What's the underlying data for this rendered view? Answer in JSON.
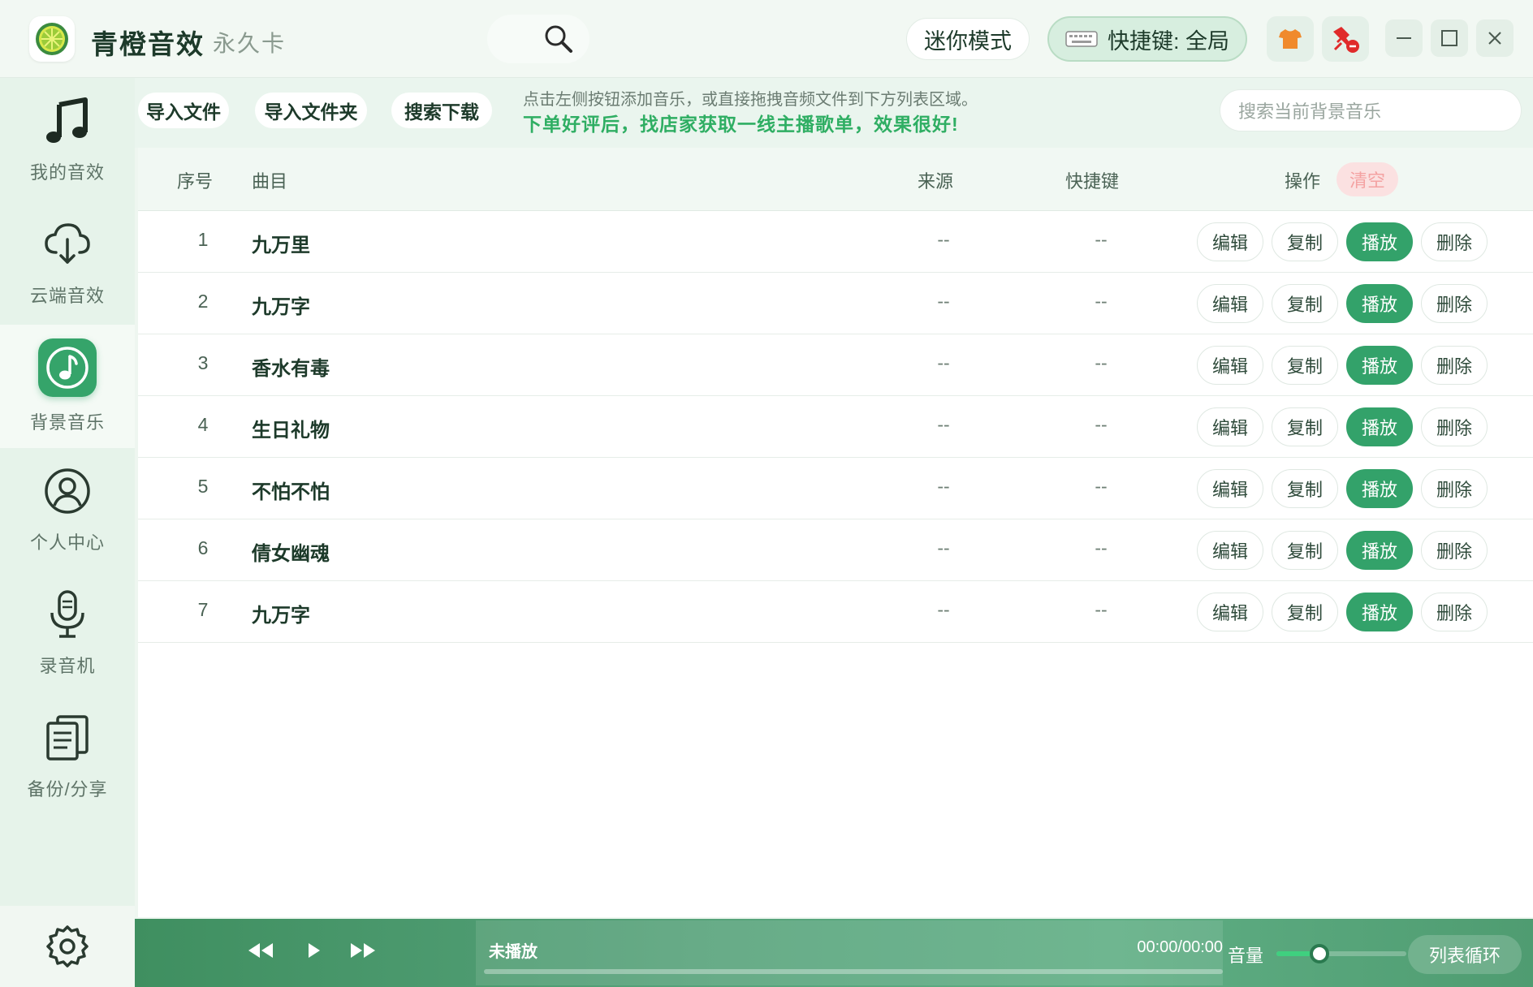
{
  "app": {
    "title": "青橙音效",
    "badge": "永久卡"
  },
  "header": {
    "mini_mode": "迷你模式",
    "hotkey_label": "快捷键: 全局",
    "icons": [
      "search-icon",
      "shirt-icon",
      "no-pin-icon",
      "minimize-icon",
      "maximize-icon",
      "close-icon"
    ]
  },
  "sidebar": {
    "items": [
      {
        "label": "我的音效",
        "icon": "music-note-icon",
        "active": false
      },
      {
        "label": "云端音效",
        "icon": "cloud-download-icon",
        "active": false
      },
      {
        "label": "背景音乐",
        "icon": "music-disc-icon",
        "active": true
      },
      {
        "label": "个人中心",
        "icon": "user-circle-icon",
        "active": false
      },
      {
        "label": "录音机",
        "icon": "microphone-icon",
        "active": false
      },
      {
        "label": "备份/分享",
        "icon": "documents-icon",
        "active": false
      }
    ],
    "settings_icon": "gear-icon"
  },
  "toolbar": {
    "import_file": "导入文件",
    "import_folder": "导入文件夹",
    "search_download": "搜索下载",
    "hint_line1": "点击左侧按钮添加音乐，或直接拖拽音频文件到下方列表区域。",
    "hint_line2": "下单好评后，找店家获取一线主播歌单，效果很好!",
    "search_placeholder": "搜索当前背景音乐"
  },
  "table": {
    "headers": {
      "index": "序号",
      "title": "曲目",
      "source": "来源",
      "hotkey": "快捷键",
      "ops": "操作",
      "clear": "清空"
    },
    "op_labels": {
      "edit": "编辑",
      "copy": "复制",
      "play": "播放",
      "delete": "删除"
    },
    "rows": [
      {
        "index": "1",
        "title": "九万里",
        "source": "--",
        "hotkey": "--"
      },
      {
        "index": "2",
        "title": "九万字",
        "source": "--",
        "hotkey": "--"
      },
      {
        "index": "3",
        "title": "香水有毒",
        "source": "--",
        "hotkey": "--"
      },
      {
        "index": "4",
        "title": "生日礼物",
        "source": "--",
        "hotkey": "--"
      },
      {
        "index": "5",
        "title": "不怕不怕",
        "source": "--",
        "hotkey": "--"
      },
      {
        "index": "6",
        "title": "倩女幽魂",
        "source": "--",
        "hotkey": "--"
      },
      {
        "index": "7",
        "title": "九万字",
        "source": "--",
        "hotkey": "--"
      }
    ]
  },
  "player": {
    "status": "未播放",
    "time": "00:00/00:00",
    "volume_label": "音量",
    "volume_fraction": 0.33,
    "loop_mode": "列表循环"
  },
  "colors": {
    "accent": "#33a26a",
    "hint_green": "#2fae63",
    "clear_red": "#f4a2a2"
  }
}
